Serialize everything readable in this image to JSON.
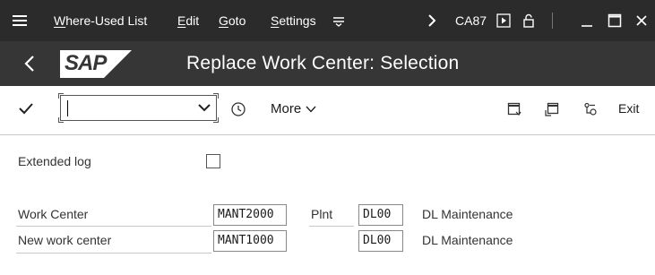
{
  "menubar": {
    "items": [
      {
        "label": "Where-Used List",
        "underline": "W"
      },
      {
        "label": "Edit",
        "underline": "E"
      },
      {
        "label": "Goto",
        "underline": "G"
      },
      {
        "label": "Settings",
        "underline": "S"
      }
    ],
    "transaction_code": "CA87"
  },
  "title_bar": {
    "logo_text": "SAP",
    "title": "Replace Work Center: Selection"
  },
  "toolbar": {
    "command_field_value": "",
    "more_label": "More",
    "exit_label": "Exit"
  },
  "form": {
    "extended_log": {
      "label": "Extended log",
      "checked": false
    },
    "work_center": {
      "label": "Work Center",
      "value": "MANT2000",
      "plant_label": "Plnt",
      "plant_value": "DL00",
      "plant_description": "DL Maintenance"
    },
    "new_work_center": {
      "label": "New work center",
      "value": "MANT1000",
      "plant_value": "DL00",
      "plant_description": "DL Maintenance"
    }
  },
  "colors": {
    "menubar_bg": "#2b2b2b",
    "titlebar_bg": "#363636",
    "text": "#1a1a1a"
  }
}
